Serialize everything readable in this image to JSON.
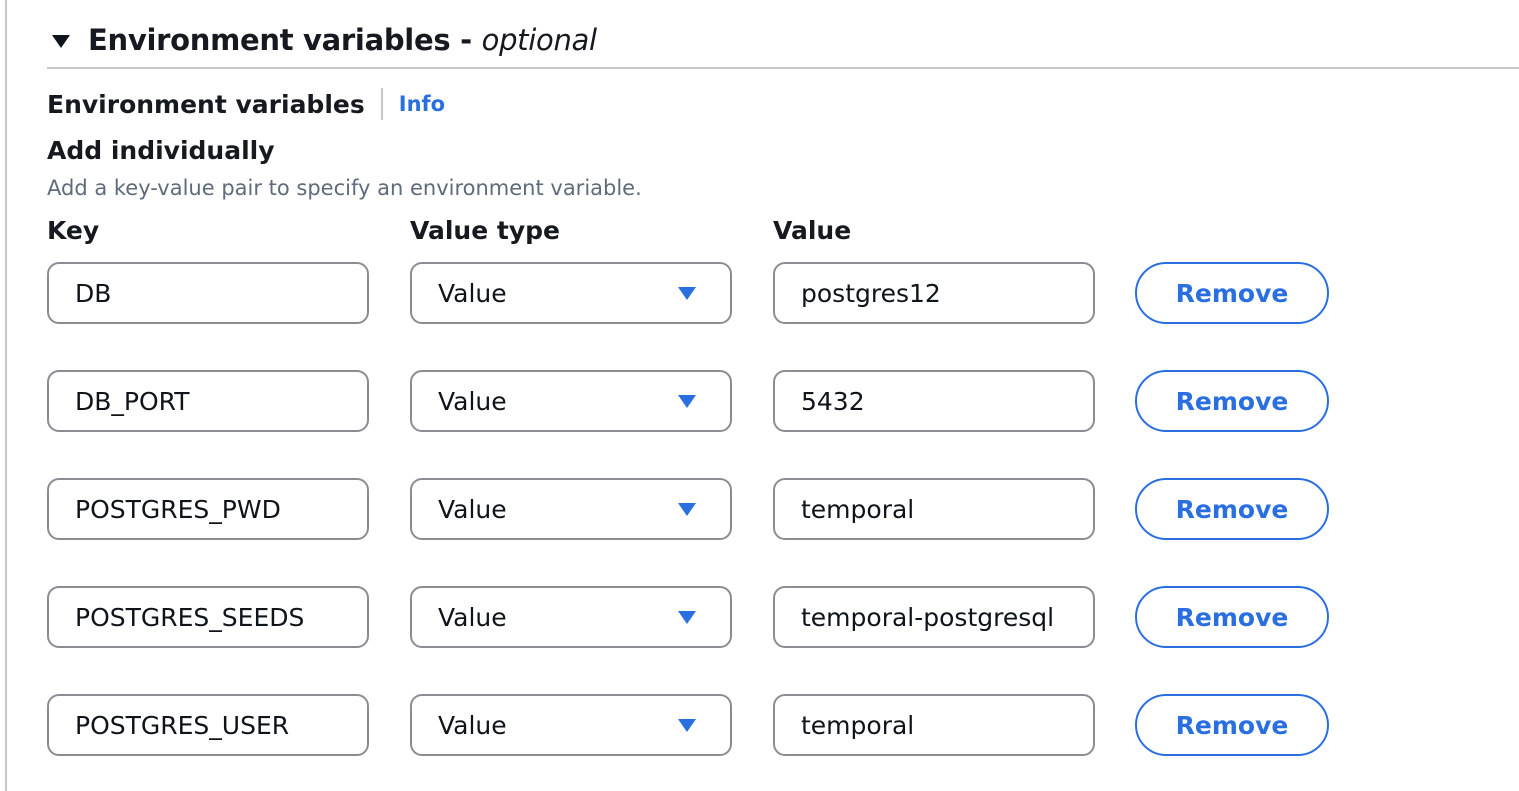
{
  "section": {
    "title": "Environment variables",
    "title_separator": " - ",
    "title_optional": "optional",
    "expanded": true
  },
  "env_vars": {
    "label": "Environment variables",
    "info_link": "Info"
  },
  "add_individually": {
    "heading": "Add individually",
    "description": "Add a key-value pair to specify an environment variable."
  },
  "columns": {
    "key": "Key",
    "value_type": "Value type",
    "value": "Value"
  },
  "rows": [
    {
      "key": "DB",
      "value_type": "Value",
      "value": "postgres12",
      "remove_label": "Remove"
    },
    {
      "key": "DB_PORT",
      "value_type": "Value",
      "value": "5432",
      "remove_label": "Remove"
    },
    {
      "key": "POSTGRES_PWD",
      "value_type": "Value",
      "value": "temporal",
      "remove_label": "Remove"
    },
    {
      "key": "POSTGRES_SEEDS",
      "value_type": "Value",
      "value": "temporal-postgresql",
      "remove_label": "Remove"
    },
    {
      "key": "POSTGRES_USER",
      "value_type": "Value",
      "value": "temporal",
      "remove_label": "Remove"
    }
  ],
  "colors": {
    "accent": "#2a6fe0",
    "text": "#0f141a",
    "muted_text": "#5f6b7a",
    "border": "#8c8c94",
    "divider": "#c6c6cd"
  }
}
